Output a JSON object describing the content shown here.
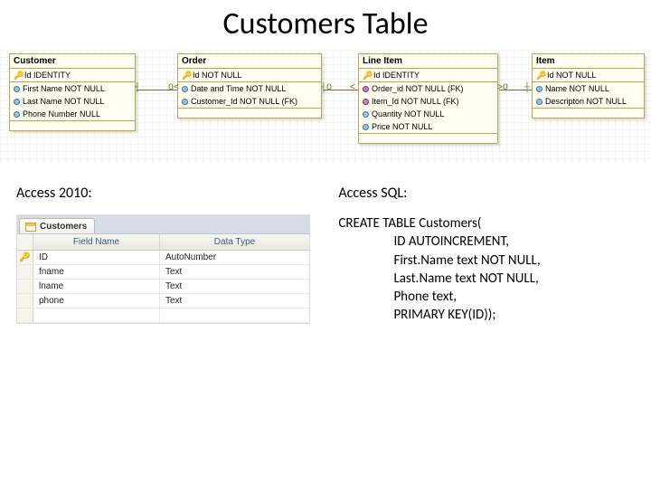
{
  "title": "Customers Table",
  "er": {
    "tables": [
      {
        "name": "Customer",
        "pk": [
          {
            "label": "Id  IDENTITY"
          }
        ],
        "cols": [
          {
            "label": "First Name  NOT NULL"
          },
          {
            "label": "Last Name  NOT NULL"
          },
          {
            "label": "Phone Number  NULL"
          }
        ]
      },
      {
        "name": "Order",
        "pk": [
          {
            "label": "Id  NOT NULL"
          }
        ],
        "cols": [
          {
            "label": "Date and Time  NOT NULL"
          },
          {
            "label": "Customer_Id  NOT NULL (FK)"
          }
        ]
      },
      {
        "name": "Line Item",
        "pk": [
          {
            "label": "Id  IDENTITY"
          }
        ],
        "cols": [
          {
            "label": "Order_id  NOT NULL (FK)"
          },
          {
            "label": "Item_Id  NOT NULL (FK)"
          },
          {
            "label": "Quantity  NOT NULL"
          },
          {
            "label": "Price  NOT NULL"
          }
        ]
      },
      {
        "name": "Item",
        "pk": [
          {
            "label": "Id  NOT NULL"
          }
        ],
        "cols": [
          {
            "label": "Name  NOT NULL"
          },
          {
            "label": "Descripton  NOT NULL"
          }
        ]
      }
    ]
  },
  "labels": {
    "access2010": "Access 2010:",
    "accessSql": "Access SQL:"
  },
  "accPanel": {
    "tab": "Customers",
    "head": {
      "c1": "Field Name",
      "c2": "Data Type"
    },
    "rows": [
      {
        "key": true,
        "c1": "ID",
        "c2": "AutoNumber"
      },
      {
        "key": false,
        "c1": "fname",
        "c2": "Text"
      },
      {
        "key": false,
        "c1": "lname",
        "c2": "Text"
      },
      {
        "key": false,
        "c1": "phone",
        "c2": "Text"
      }
    ]
  },
  "sql": {
    "l1": "CREATE TABLE Customers(",
    "l2": "ID AUTOINCREMENT,",
    "l3": "First.Name text NOT NULL,",
    "l4": "Last.Name text NOT NULL,",
    "l5": "Phone text,",
    "l6": "PRIMARY KEY(ID));"
  }
}
